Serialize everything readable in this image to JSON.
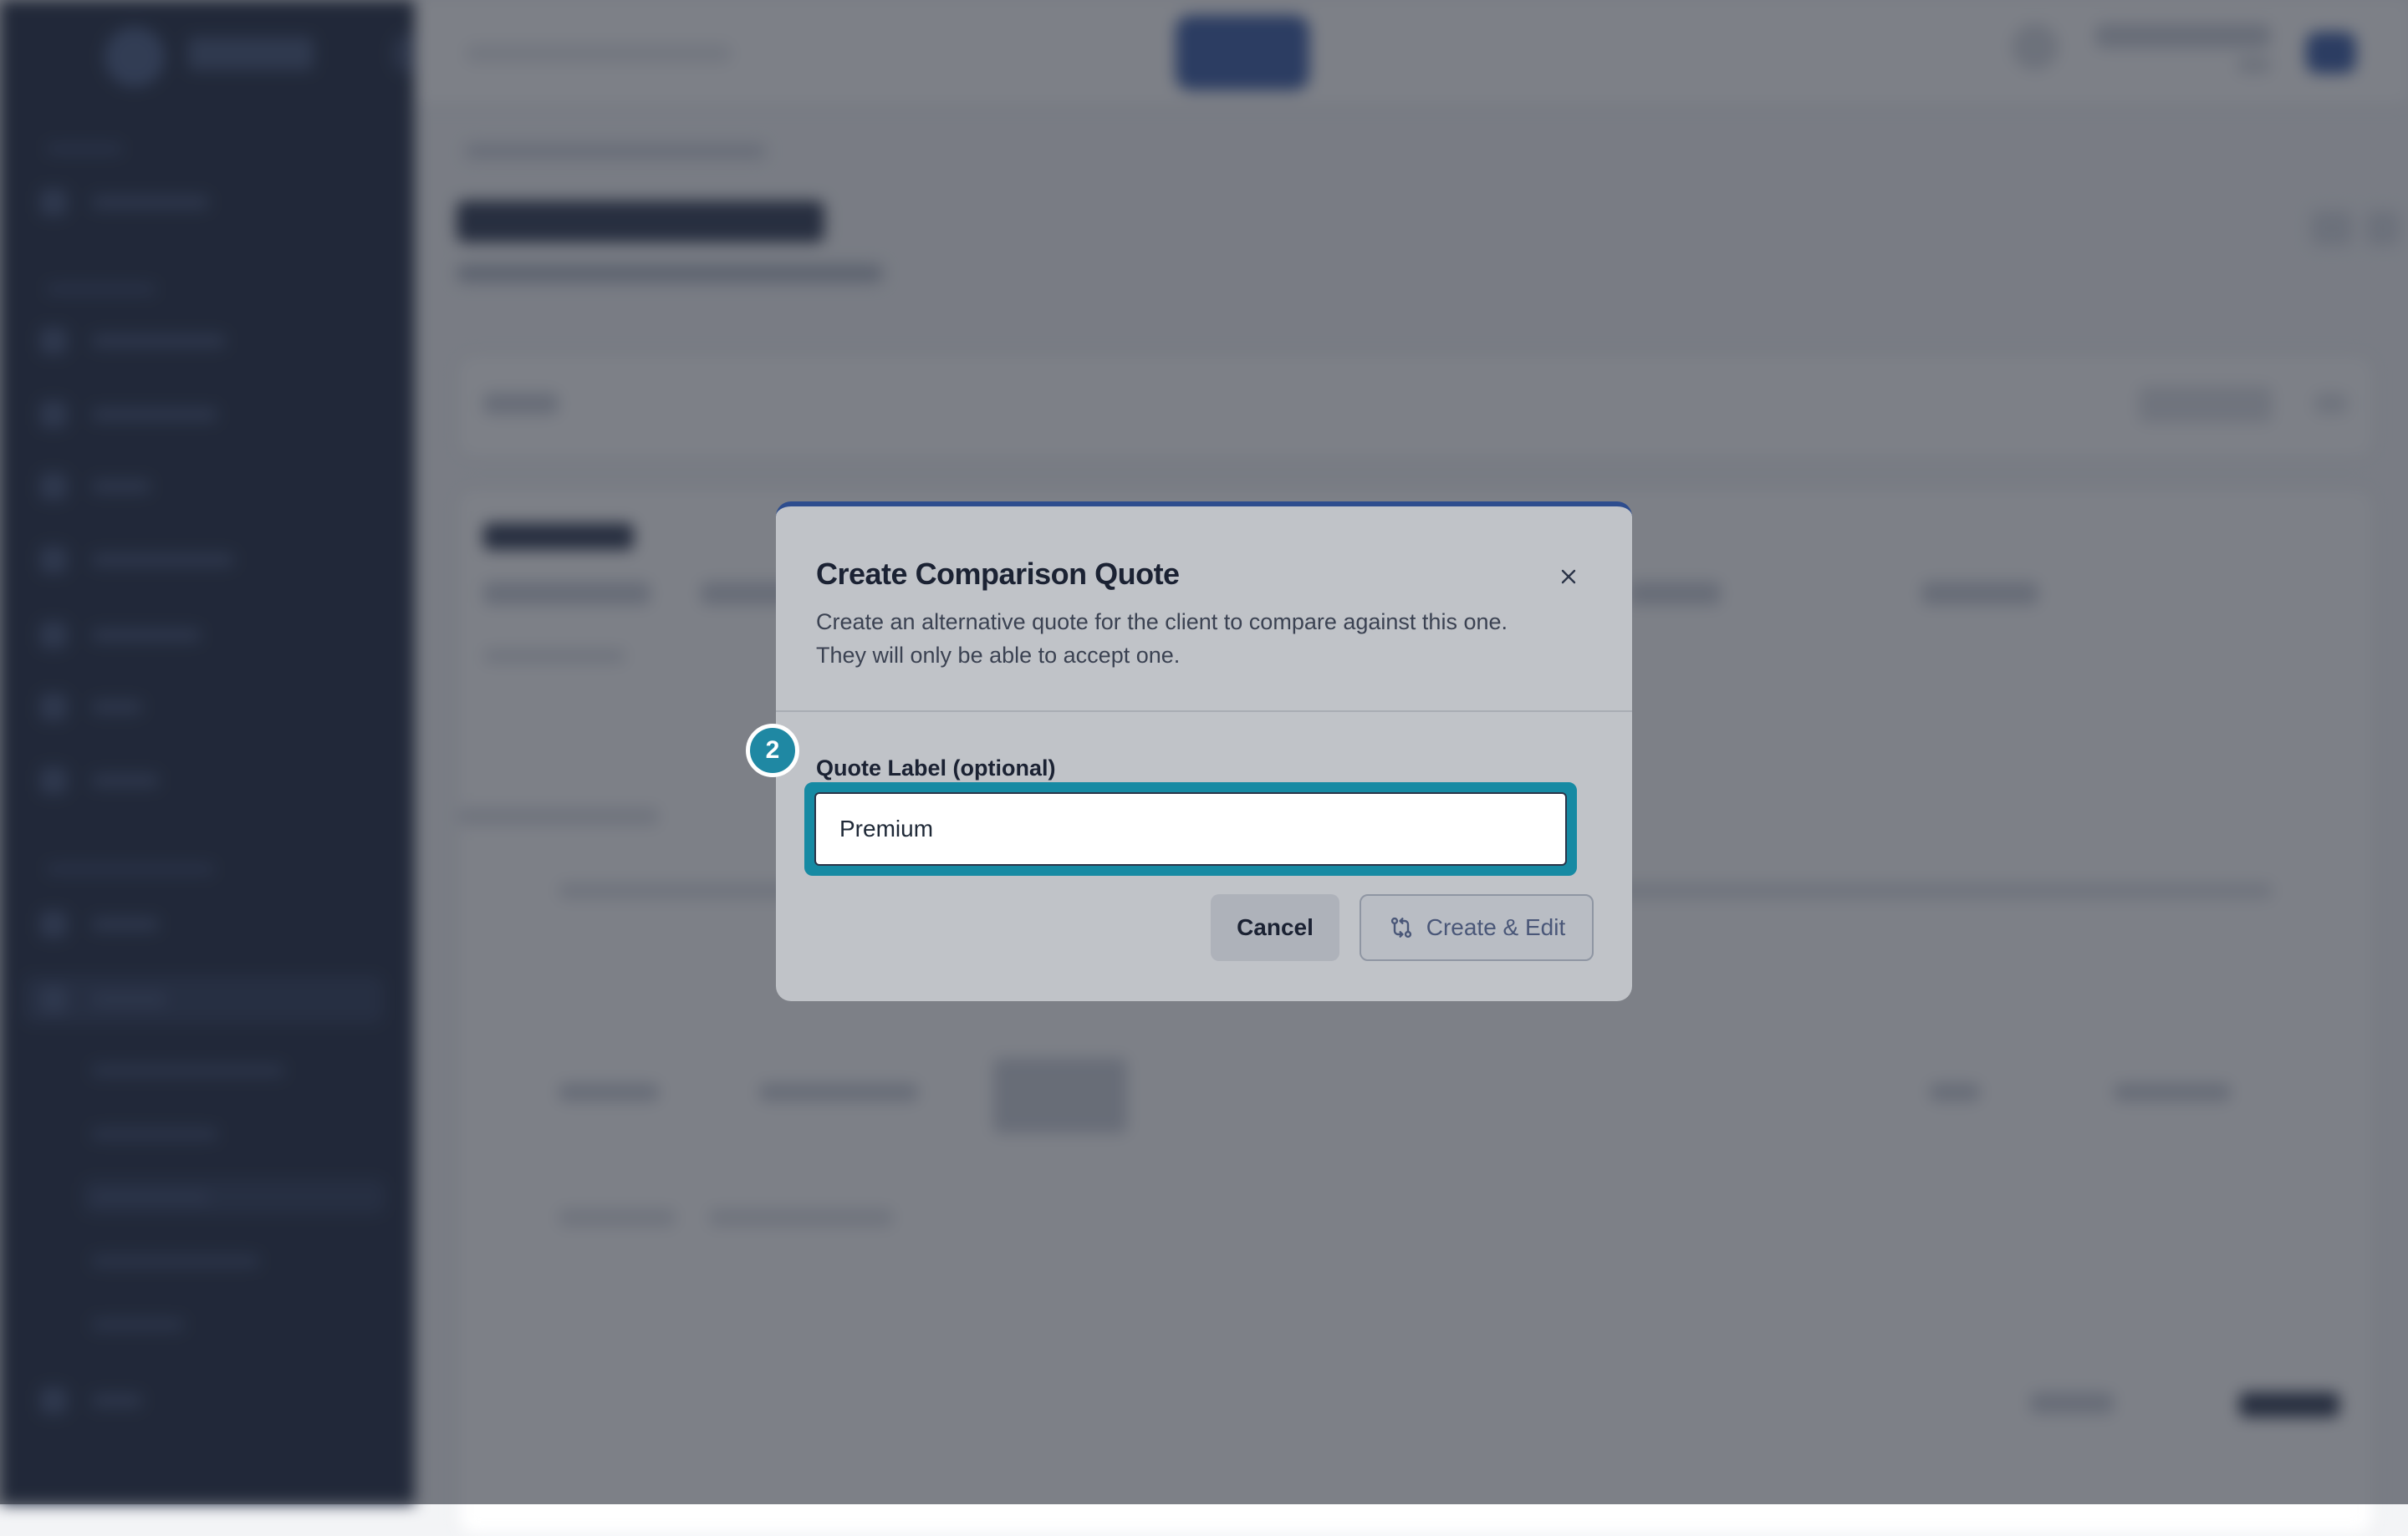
{
  "modal": {
    "title": "Create Comparison Quote",
    "description": "Create an alternative quote for the client to compare against this one. They will only be able to accept one.",
    "close_icon": "close-icon",
    "field_label": "Quote Label (optional)",
    "field_value": "Premium",
    "cancel_label": "Cancel",
    "create_label": "Create & Edit",
    "create_icon": "compare-arrows-icon"
  },
  "step_badge": {
    "number": "2"
  },
  "colors": {
    "accent": "#168aa3",
    "modal_top_border": "#2e4d8e",
    "sidebar": "#0f1a33",
    "overlay": "rgba(45,50,62,0.62)"
  }
}
